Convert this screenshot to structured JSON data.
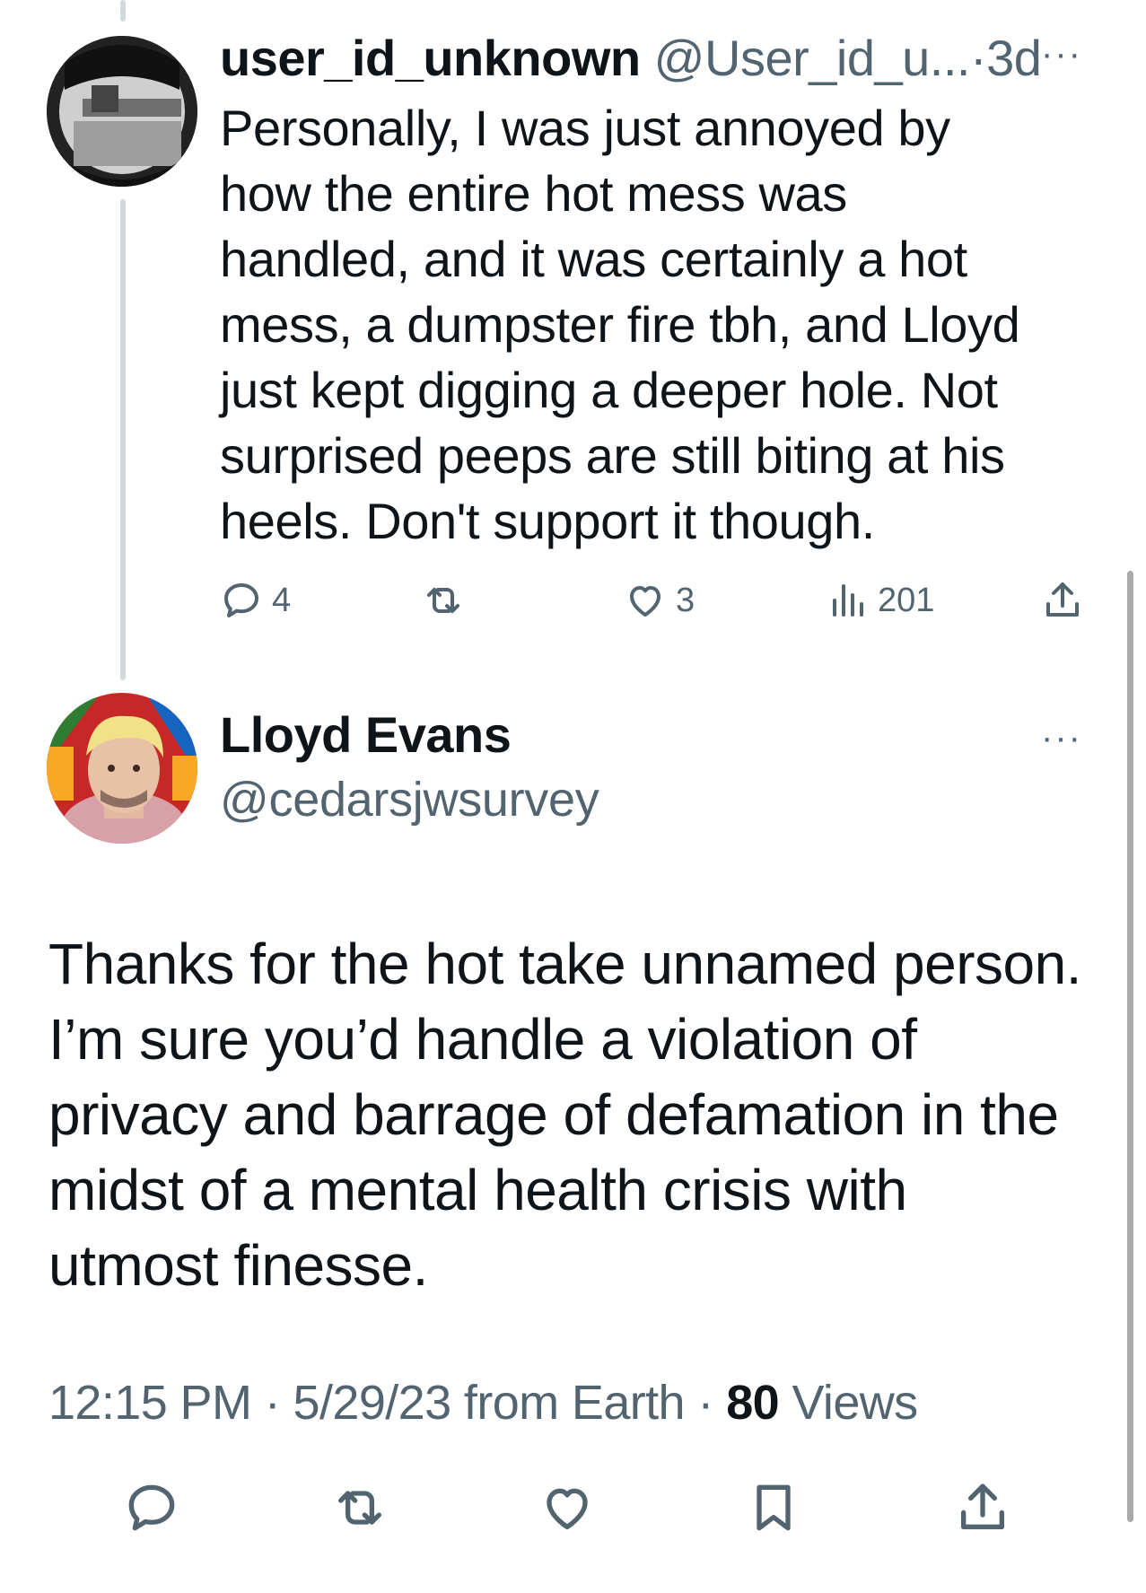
{
  "parent_tweet": {
    "display_name": "user_id_unknown",
    "handle": "@User_id_u...",
    "separator": "·",
    "time": "3d",
    "text_lines": [
      "Personally, I was just annoyed by",
      "how the entire hot mess was",
      "handled, and it was certainly a hot",
      "mess, a dumpster fire tbh, and Lloyd",
      "just kept digging a deeper hole.  Not",
      "surprised peeps are still biting at his",
      "heels.  Don't support it though."
    ],
    "stats": {
      "replies": "4",
      "retweets": "",
      "likes": "3",
      "views": "201"
    },
    "more_label": "···"
  },
  "main_tweet": {
    "display_name": "Lloyd Evans",
    "handle": "@cedarsjwsurvey",
    "more_label": "···",
    "text_lines": [
      "Thanks for the hot take unnamed person.",
      "I’m sure you’d handle a violation of",
      "privacy and barrage of defamation in the",
      "midst of a mental health crisis with",
      "utmost finesse."
    ],
    "meta": {
      "time": "12:15 PM",
      "sep1": " · ",
      "date": "5/29/23",
      "source": " from Earth",
      "sep2": " · ",
      "views_count": "80",
      "views_label": " Views"
    }
  },
  "icons": {
    "reply": "reply-icon",
    "retweet": "retweet-icon",
    "like": "heart-icon",
    "views": "analytics-icon",
    "share": "share-icon",
    "bookmark": "bookmark-icon"
  },
  "colors": {
    "text": "#0f1419",
    "secondary": "#536471",
    "thread_line": "#cfd9de"
  }
}
